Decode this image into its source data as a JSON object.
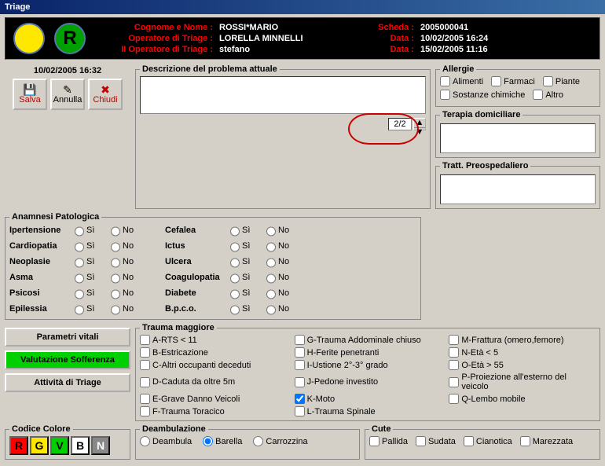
{
  "window": {
    "title": "Triage"
  },
  "header": {
    "labels": {
      "cognome": "Cognome e Nome :",
      "op1": "Operatore di Triage :",
      "op2": "II Operatore di Triage :",
      "scheda": "Scheda :",
      "data1": "Data :",
      "data2": "Data :"
    },
    "values": {
      "cognome": "ROSSI*MARIO",
      "op1": "LORELLA MINNELLI",
      "op2": "stefano",
      "scheda": "2005000041",
      "data1": "10/02/2005 16:24",
      "data2": "15/02/2005 11:16"
    },
    "green_letter": "R"
  },
  "timestamp": "10/02/2005 16:32",
  "buttons": {
    "salva": "Salva",
    "annulla": "Annulla",
    "chiudi": "Chiudi",
    "parametri": "Parametri vitali",
    "sofferenza": "Valutazione Sofferenza",
    "attivita": "Attività di Triage"
  },
  "sections": {
    "descrizione": "Descrizione del problema attuale",
    "allergie": "Allergie",
    "terapia": "Terapia domiciliare",
    "tratt": "Tratt. Preospedaliero",
    "anamnesi": "Anamnesi Patologica",
    "trauma": "Trauma maggiore",
    "codice": "Codice Colore",
    "deamb": "Deambulazione",
    "cute": "Cute"
  },
  "desc_counter": "2/2",
  "allergie_items": [
    "Alimenti",
    "Farmaci",
    "Piante",
    "Sostanze chimiche",
    "Altro"
  ],
  "anamnesi_items": [
    [
      "Ipertensione",
      "Cardiopatia",
      "Neoplasie",
      "Asma",
      "Psicosi",
      "Epilessia"
    ],
    [
      "Cefalea",
      "Ictus",
      "Ulcera",
      "Coagulopatia",
      "Diabete",
      "B.p.c.o."
    ]
  ],
  "radio_labels": {
    "si": "Sì",
    "no": "No"
  },
  "trauma_items": [
    "A-RTS < 11",
    "G-Trauma Addominale chiuso",
    "M-Frattura (omero,femore)",
    "B-Estricazione",
    "H-Ferite penetranti",
    "N-Età < 5",
    "C-Altri occupanti deceduti",
    "I-Ustione 2°-3° grado",
    "O-Età > 55",
    "D-Caduta da oltre 5m",
    "J-Pedone investito",
    "P-Proiezione all'esterno del veicolo",
    "E-Grave Danno Veicoli",
    "K-Moto",
    "Q-Lembo mobile",
    "F-Trauma Toracico",
    "L-Trauma Spinale",
    ""
  ],
  "trauma_checked": [
    "K-Moto"
  ],
  "codice_buttons": [
    "R",
    "G",
    "V",
    "B",
    "N"
  ],
  "deamb_items": [
    "Deambula",
    "Barella",
    "Carrozzina"
  ],
  "deamb_selected": "Barella",
  "cute_items": [
    "Pallida",
    "Sudata",
    "Cianotica",
    "Marezzata"
  ]
}
